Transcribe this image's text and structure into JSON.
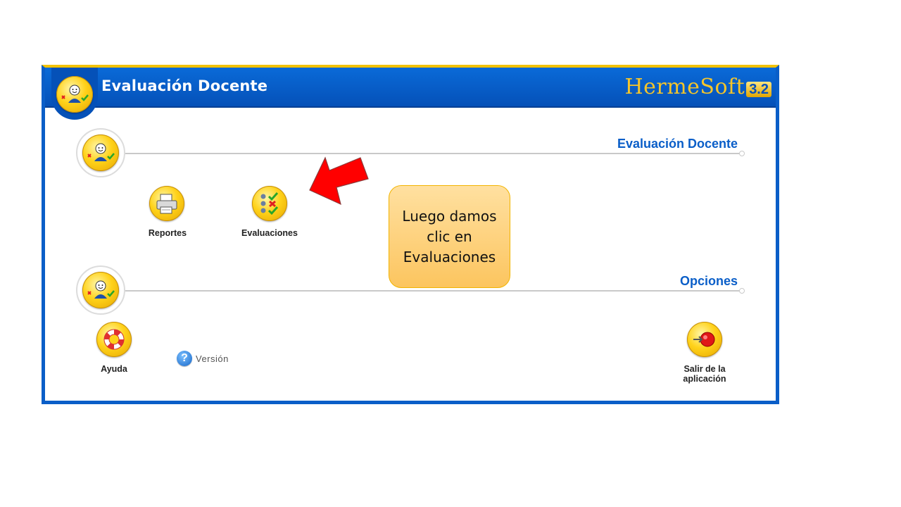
{
  "app": {
    "header_title": "Evaluación Docente",
    "brand_name": "HermeSoft",
    "brand_version": "3.2"
  },
  "sections": {
    "evaluacion": {
      "title": "Evaluación Docente",
      "items": {
        "reportes": "Reportes",
        "evaluaciones": "Evaluaciones"
      }
    },
    "opciones": {
      "title": "Opciones",
      "items": {
        "ayuda": "Ayuda",
        "version": "Versión",
        "salir": "Salir de la aplicación"
      }
    }
  },
  "annotation": {
    "callout_text": "Luego damos clic en Evaluaciones",
    "arrow_color": "#ff0000"
  },
  "colors": {
    "accent_blue": "#0a5ec8",
    "header_top_border": "#f2c200",
    "icon_yellow": "#ffd21a"
  },
  "icons": {
    "header": "teacher-evaluation-icon",
    "reportes": "printer-icon",
    "evaluaciones": "checklist-icon",
    "ayuda": "lifebuoy-icon",
    "version": "question-icon",
    "salir": "exit-icon"
  }
}
